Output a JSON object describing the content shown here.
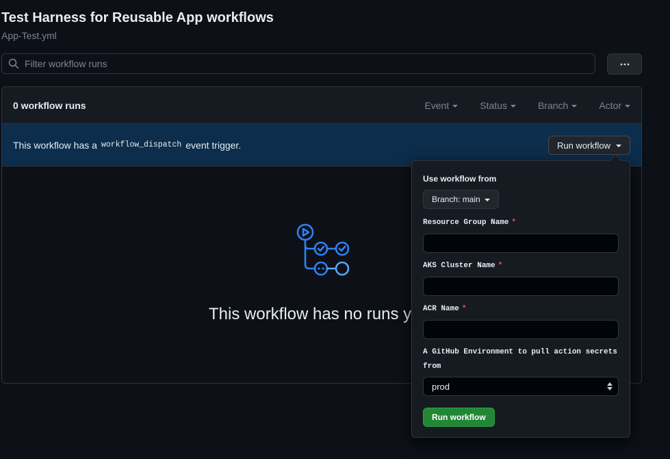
{
  "header": {
    "title": "Test Harness for Reusable App workflows",
    "filename": "App-Test.yml"
  },
  "search": {
    "placeholder": "Filter workflow runs"
  },
  "more_button": {
    "icon": "kebab-horizontal-icon"
  },
  "runs": {
    "count_label": "0 workflow runs",
    "filters": [
      "Event",
      "Status",
      "Branch",
      "Actor"
    ]
  },
  "dispatch": {
    "prefix": "This workflow has a",
    "code": "workflow_dispatch",
    "suffix": "event trigger.",
    "run_button_label": "Run workflow"
  },
  "empty_state": {
    "icon": "workflow-icon",
    "message": "This workflow has no runs y"
  },
  "popover": {
    "use_from_label": "Use workflow from",
    "branch_button_label": "Branch: main",
    "inputs": [
      {
        "label": "Resource Group Name",
        "required_mark": "*",
        "value": ""
      },
      {
        "label": "AKS Cluster Name",
        "required_mark": "*",
        "value": ""
      },
      {
        "label": "ACR Name",
        "required_mark": "*",
        "value": ""
      }
    ],
    "env_label_line1": "A GitHub Environment to pull action secrets",
    "env_label_line2": "from",
    "env_selected": "prod",
    "submit_label": "Run workflow"
  },
  "colors": {
    "background": "#0d1117",
    "accent_blue": "#2f81f7",
    "dispatch_bar": "#0c2d4b",
    "success_green": "#238636",
    "required_red": "#f85149"
  }
}
